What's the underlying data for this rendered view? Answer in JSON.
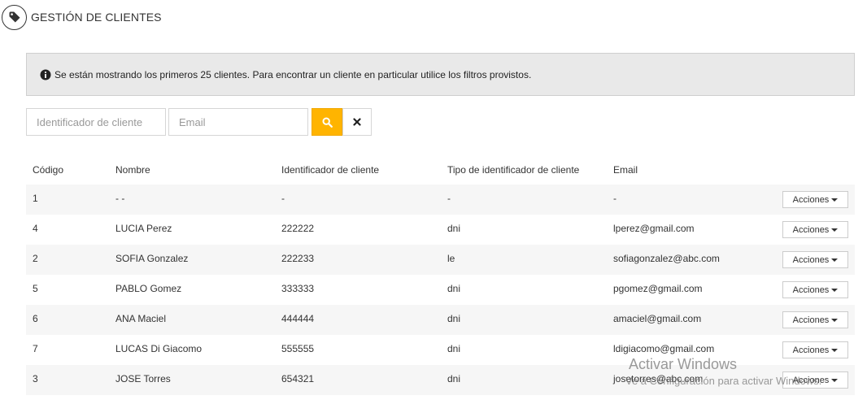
{
  "header": {
    "title": "GESTIÓN DE CLIENTES",
    "icon": "tag-icon"
  },
  "banner": {
    "icon": "info-circle-icon",
    "text": "Se están mostrando los primeros 25 clientes. Para encontrar un cliente en particular utilice los filtros provistos."
  },
  "filters": {
    "id_placeholder": "Identificador de cliente",
    "id_value": "",
    "email_placeholder": "Email",
    "email_value": "",
    "search_icon": "search-icon",
    "clear_icon": "times-icon",
    "accent": "#ffb400"
  },
  "table": {
    "headers": [
      "Código",
      "Nombre",
      "Identificador de cliente",
      "Tipo de identificador de cliente",
      "Email"
    ],
    "rows": [
      {
        "codigo": "1",
        "nombre": "- -",
        "identificador": "-",
        "tipo": "-",
        "email": "-",
        "action": "Acciones"
      },
      {
        "codigo": "4",
        "nombre": "LUCIA Perez",
        "identificador": "222222",
        "tipo": "dni",
        "email": "lperez@gmail.com",
        "action": "Acciones"
      },
      {
        "codigo": "2",
        "nombre": "SOFIA Gonzalez",
        "identificador": "222233",
        "tipo": "le",
        "email": "sofiagonzalez@abc.com",
        "action": "Acciones"
      },
      {
        "codigo": "5",
        "nombre": "PABLO Gomez",
        "identificador": "333333",
        "tipo": "dni",
        "email": "pgomez@gmail.com",
        "action": "Acciones"
      },
      {
        "codigo": "6",
        "nombre": "ANA Maciel",
        "identificador": "444444",
        "tipo": "dni",
        "email": "amaciel@gmail.com",
        "action": "Acciones"
      },
      {
        "codigo": "7",
        "nombre": "LUCAS Di Giacomo",
        "identificador": "555555",
        "tipo": "dni",
        "email": "ldigiacomo@gmail.com",
        "action": "Acciones"
      },
      {
        "codigo": "3",
        "nombre": "JOSE Torres",
        "identificador": "654321",
        "tipo": "dni",
        "email": "josetorres@abc.com",
        "action": "Acciones"
      }
    ]
  },
  "watermark": {
    "title": "Activar Windows",
    "subtitle": "Ve a Configuración para activar Windows."
  }
}
